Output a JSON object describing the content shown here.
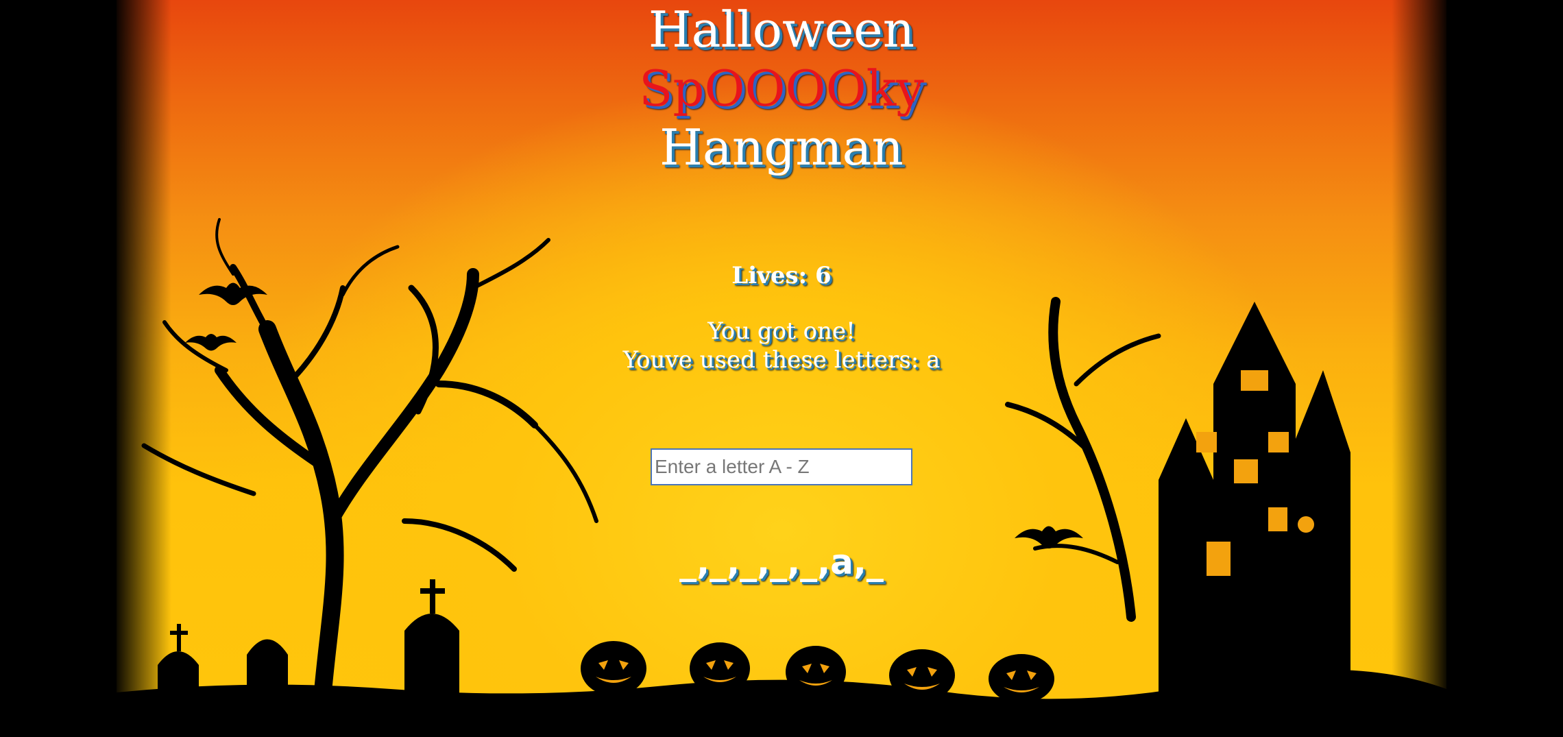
{
  "title": {
    "line1": "Halloween",
    "line2": "SpOOOOky",
    "line3": "Hangman"
  },
  "game": {
    "lives_text": "Lives: 6",
    "message": "You got one!",
    "used_letters_text": "Youve used these letters: a",
    "input_placeholder": "Enter a letter A - Z",
    "word_display": "_,_,_,_,_,a,_"
  },
  "colors": {
    "sky_top": "#e8470e",
    "sky_bottom": "#ffc60b",
    "title_text": "#ffffff",
    "spooky_text": "#e8141c",
    "text_shadow": "#2a7fb0"
  }
}
